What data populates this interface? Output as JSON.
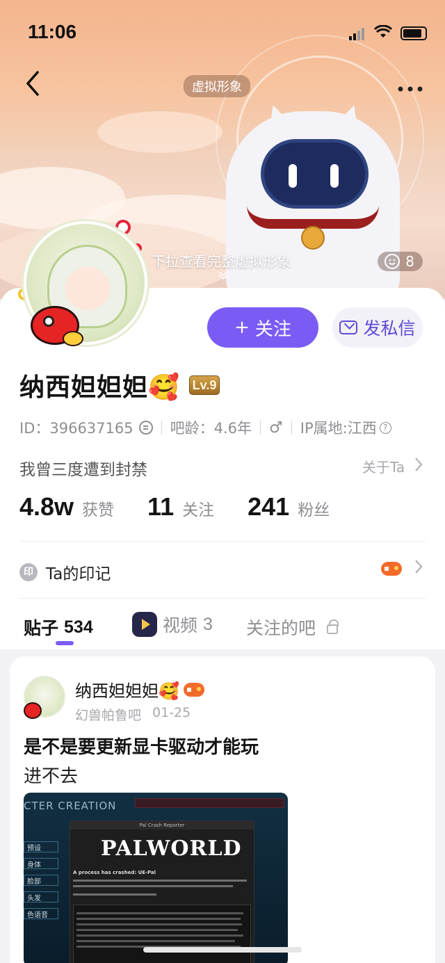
{
  "status_bar": {
    "time": "11:06"
  },
  "header": {
    "avatar_tag": "虚拟形象",
    "pull_hint": "下拉查看完整虚拟形象",
    "like_count": "8"
  },
  "profile": {
    "follow_button": "关注",
    "follow_plus": "+",
    "dm_button": "发私信",
    "nickname": "纳西妲妲妲🥰",
    "level": "Lv.9",
    "id_label": "ID：396637165",
    "age_label": "吧龄：4.6年",
    "gender_symbol": "♂",
    "ip_label": "IP属地:江西",
    "bio": "我曾三度遭到封禁",
    "about_label": "关于Ta",
    "stats": [
      {
        "value": "4.8w",
        "label": "获赞"
      },
      {
        "value": "11",
        "label": "关注"
      },
      {
        "value": "241",
        "label": "粉丝"
      }
    ],
    "imprint_icon_char": "印",
    "imprint_label": "Ta的印记"
  },
  "tabs": [
    {
      "label": "贴子",
      "count": "534"
    },
    {
      "label": "视频",
      "count": "3"
    },
    {
      "label": "关注的吧"
    }
  ],
  "post": {
    "author": "纳西妲妲妲🥰",
    "forum": "幻兽帕鲁吧",
    "date": "01-25",
    "title": "是不是要更新显卡驱动才能玩",
    "body": "进不去",
    "image": {
      "heading": "CTER CREATION",
      "window_title": "Pal Crash Reporter",
      "logo": "PALWORLD",
      "crash_line": "A process has crashed: UE-Pal",
      "side_items": [
        "预设",
        "身体",
        "脸部",
        "头发",
        "色语音"
      ]
    }
  },
  "colors": {
    "accent": "#7a5cf5",
    "dm_bg": "#f3f1f8"
  }
}
